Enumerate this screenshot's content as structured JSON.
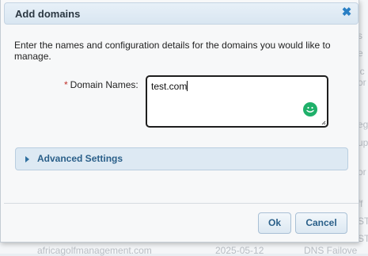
{
  "dialog": {
    "title": "Add domains",
    "intro": "Enter the names and configuration details for the domains you would like to manage.",
    "required_marker": "*",
    "domain_names_label": "Domain Names:",
    "domain_names_value": "test.com",
    "advanced_settings_label": "Advanced Settings",
    "ok_label": "Ok",
    "cancel_label": "Cancel"
  },
  "background": {
    "right_fragments": [
      "s",
      "e",
      "ic",
      "or",
      "eg",
      "up",
      "or",
      "ff",
      "ST",
      "ST"
    ],
    "row": {
      "domain": "africagolfmanagement.com",
      "date": "2025-05-12",
      "status": "DNS Failove"
    }
  },
  "colors": {
    "accent": "#2a5f89",
    "required": "#c0302a",
    "grammarly": "#1fb06a"
  }
}
